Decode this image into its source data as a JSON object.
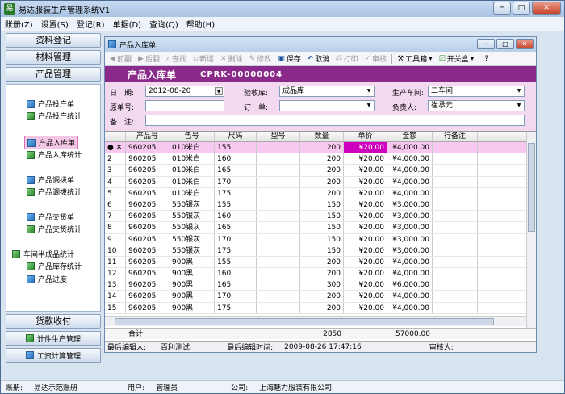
{
  "app": {
    "title": "易达服装生产管理系统V1"
  },
  "menu": [
    "账册(Z)",
    "设置(S)",
    "登记(R)",
    "单据(D)",
    "查询(Q)",
    "帮助(H)"
  ],
  "sidebar": {
    "top_buttons": [
      "资料登记",
      "材料管理",
      "产品管理"
    ],
    "links": [
      {
        "label": "产品投产单"
      },
      {
        "label": "产品投产统计"
      },
      {
        "label": "产品入库单"
      },
      {
        "label": "产品入库统计"
      },
      {
        "label": "产品调拨单"
      },
      {
        "label": "产品调拨统计"
      },
      {
        "label": "产品交货单"
      },
      {
        "label": "产品交货统计"
      },
      {
        "label": "车间半成品统计"
      },
      {
        "label": "产品库存统计"
      },
      {
        "label": "产品进度"
      }
    ],
    "bottom_buttons": [
      "货款收付",
      "计件生产管理",
      "工资计算管理"
    ]
  },
  "child": {
    "title": "产品入库单",
    "toolbar": [
      "前翻",
      "后翻",
      "查找",
      "新增",
      "删除",
      "修改",
      "保存",
      "取消",
      "打印",
      "审核",
      "工具箱",
      "开关盒"
    ],
    "form_title": "产品入库单",
    "doc_no": "CPRK-00000004",
    "form": {
      "date_label": "日　期:",
      "date_value": "2012-08-20",
      "warehouse_label": "验收库:",
      "warehouse_value": "成品库",
      "workshop_label": "生产车间:",
      "workshop_value": "二车间",
      "orig_label": "原单号:",
      "order_label": "订　单:",
      "manager_label": "负责人:",
      "manager_value": "崔承元",
      "remark_label": "备　注:"
    },
    "columns": [
      "",
      "产品号",
      "色号",
      "尺码",
      "型号",
      "数量",
      "单价",
      "金额",
      "行备注"
    ],
    "rows": [
      [
        "1",
        "960205",
        "010米白",
        "155",
        "",
        "200",
        "¥20.00",
        "¥4,000.00",
        ""
      ],
      [
        "2",
        "960205",
        "010米白",
        "160",
        "",
        "200",
        "¥20.00",
        "¥4,000.00",
        ""
      ],
      [
        "3",
        "960205",
        "010米白",
        "165",
        "",
        "200",
        "¥20.00",
        "¥4,000.00",
        ""
      ],
      [
        "4",
        "960205",
        "010米白",
        "170",
        "",
        "200",
        "¥20.00",
        "¥4,000.00",
        ""
      ],
      [
        "5",
        "960205",
        "010米白",
        "175",
        "",
        "200",
        "¥20.00",
        "¥4,000.00",
        ""
      ],
      [
        "6",
        "960205",
        "550银灰",
        "155",
        "",
        "150",
        "¥20.00",
        "¥3,000.00",
        ""
      ],
      [
        "7",
        "960205",
        "550银灰",
        "160",
        "",
        "150",
        "¥20.00",
        "¥3,000.00",
        ""
      ],
      [
        "8",
        "960205",
        "550银灰",
        "165",
        "",
        "150",
        "¥20.00",
        "¥3,000.00",
        ""
      ],
      [
        "9",
        "960205",
        "550银灰",
        "170",
        "",
        "150",
        "¥20.00",
        "¥3,000.00",
        ""
      ],
      [
        "10",
        "960205",
        "550银灰",
        "175",
        "",
        "150",
        "¥20.00",
        "¥3,000.00",
        ""
      ],
      [
        "11",
        "960205",
        "900黑",
        "155",
        "",
        "200",
        "¥20.00",
        "¥4,000.00",
        ""
      ],
      [
        "12",
        "960205",
        "900黑",
        "160",
        "",
        "200",
        "¥20.00",
        "¥4,000.00",
        ""
      ],
      [
        "13",
        "960205",
        "900黑",
        "165",
        "",
        "300",
        "¥20.00",
        "¥6,000.00",
        ""
      ],
      [
        "14",
        "960205",
        "900黑",
        "170",
        "",
        "200",
        "¥20.00",
        "¥4,000.00",
        ""
      ],
      [
        "15",
        "960205",
        "900黑",
        "175",
        "",
        "200",
        "¥20.00",
        "¥4,000.00",
        ""
      ]
    ],
    "total_label": "合计:",
    "total_qty": "2850",
    "total_amount": "57000.00",
    "status": {
      "editor_label": "最后编辑人:",
      "editor_value": "百利测试",
      "time_label": "最后编辑时间:",
      "time_value": "2009-08-26 17:47:16",
      "auditor_label": "审核人:"
    }
  },
  "statusbar": {
    "account_label": "账册:",
    "account_value": "易达示范账册",
    "user_label": "用户:",
    "user_value": "管理员",
    "company_label": "公司:",
    "company_value": "上海魅力服装有限公司"
  }
}
